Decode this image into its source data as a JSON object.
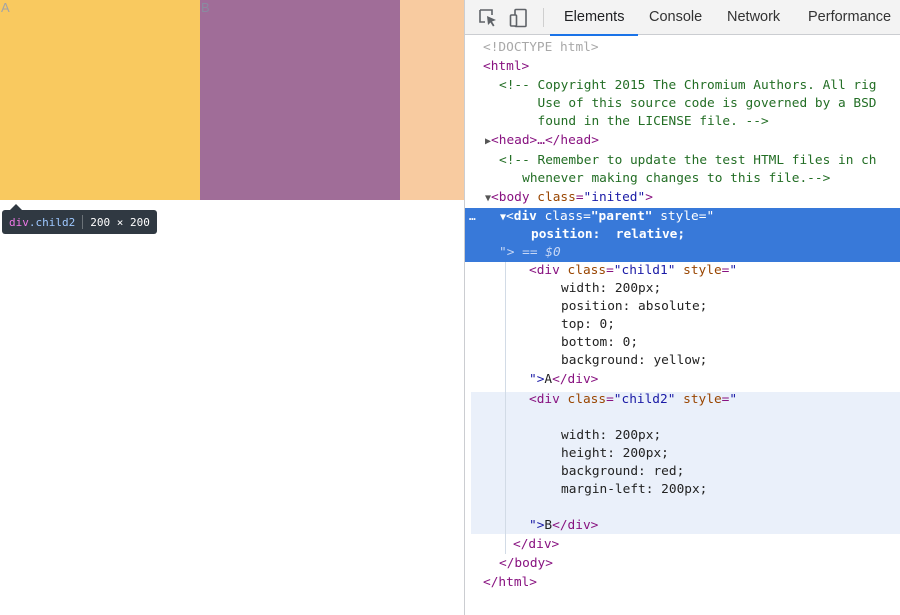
{
  "page": {
    "box_a_label": "A",
    "box_b_label": "B",
    "colors": {
      "child1": "#f9c95f",
      "child2": "#a06d98",
      "parent_margin": "#f8cba0"
    }
  },
  "tooltip": {
    "tag": "div",
    "class_name": ".child2",
    "dimensions": "200 × 200"
  },
  "devtools": {
    "toolbar": {
      "icons": [
        "inspect-element-icon",
        "device-toolbar-icon"
      ],
      "tabs": [
        {
          "label": "Elements",
          "active": true
        },
        {
          "label": "Console",
          "active": false
        },
        {
          "label": "Network",
          "active": false
        },
        {
          "label": "Performance",
          "active": false
        }
      ]
    },
    "tree": {
      "doctype": "<!DOCTYPE html>",
      "html_open": "<html>",
      "comment1": [
        "<!-- Copyright 2015 The Chromium Authors. All rig",
        "     Use of this source code is governed by a BSD",
        "     found in the LICENSE file. -->"
      ],
      "head": "<head>…</head>",
      "comment2": [
        "<!-- Remember to update the test HTML files in ch",
        "   whenever making changes to this file.-->"
      ],
      "body_tag": "body",
      "body_attr": "class",
      "body_val": "\"inited\"",
      "parent_tag": "div",
      "parent_class": "\"parent\"",
      "parent_style_attr": "style",
      "parent_style_open": "\"",
      "parent_css": "position:  relative;",
      "parent_close": "\">",
      "dollar_zero": "== $0",
      "child1_class": "\"child1\"",
      "child1_css": [
        "width: 200px;",
        "position: absolute;",
        "top: 0;",
        "bottom: 0;",
        "background: yellow;"
      ],
      "child1_text": "A",
      "child2_class": "\"child2\"",
      "child2_css": [
        "width: 200px;",
        "height: 200px;",
        "background: red;",
        "margin-left: 200px;"
      ],
      "child2_text": "B",
      "div_close": "</div>",
      "body_close": "</body>",
      "html_close": "</html>"
    }
  }
}
